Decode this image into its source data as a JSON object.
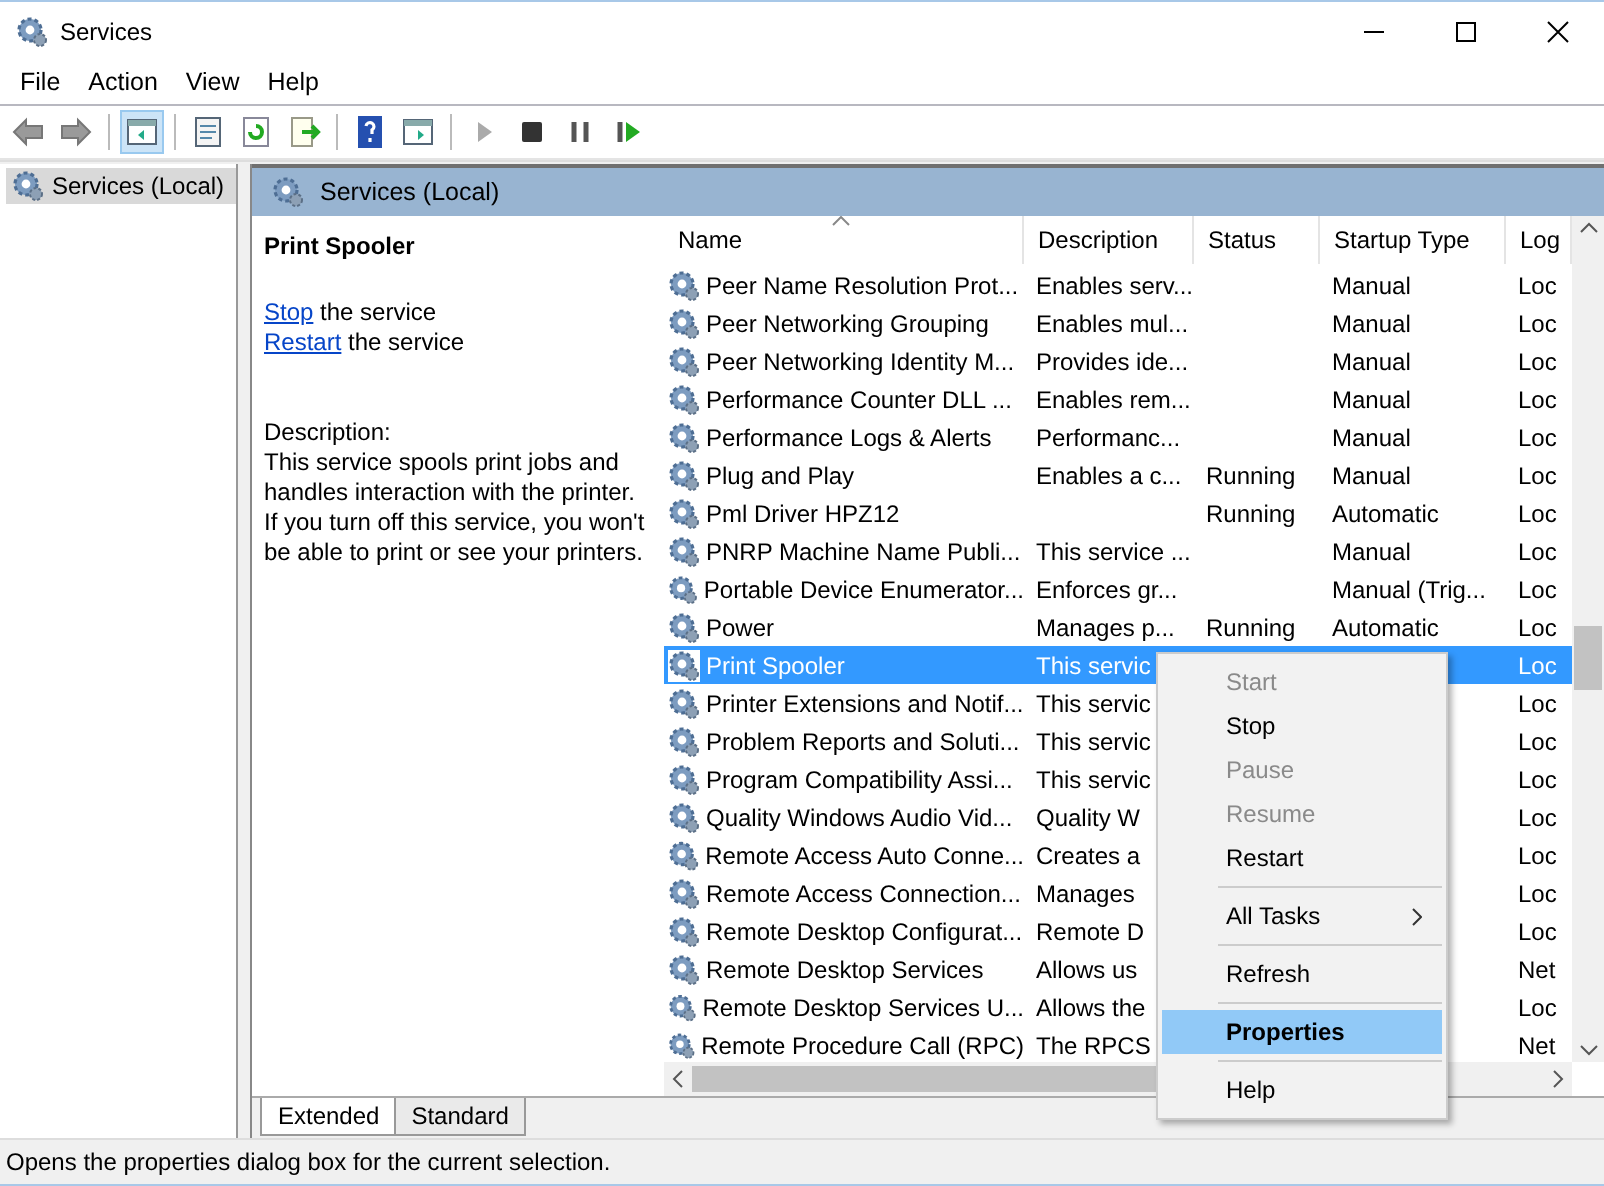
{
  "window": {
    "title": "Services"
  },
  "menu_bar": [
    "File",
    "Action",
    "View",
    "Help"
  ],
  "toolbar": [
    {
      "kind": "back",
      "disabled": true,
      "selected": false
    },
    {
      "kind": "forward",
      "disabled": true,
      "selected": false
    },
    {
      "kind": "sep"
    },
    {
      "kind": "console-tree",
      "disabled": false,
      "selected": true
    },
    {
      "kind": "sep"
    },
    {
      "kind": "properties",
      "selected": false
    },
    {
      "kind": "refresh",
      "selected": false
    },
    {
      "kind": "export",
      "selected": false
    },
    {
      "kind": "sep"
    },
    {
      "kind": "help",
      "selected": false
    },
    {
      "kind": "action-pane",
      "selected": false
    },
    {
      "kind": "sep"
    },
    {
      "kind": "start",
      "disabled": true,
      "selected": false
    },
    {
      "kind": "stop",
      "disabled": false,
      "selected": false
    },
    {
      "kind": "pause",
      "disabled": false,
      "selected": false
    },
    {
      "kind": "resume",
      "disabled": false,
      "selected": false
    }
  ],
  "tree": {
    "items": [
      {
        "label": "Services (Local)",
        "selected": true
      }
    ]
  },
  "pane_header": "Services (Local)",
  "details": {
    "title": "Print Spooler",
    "actions": [
      {
        "link": "Stop",
        "text": "the service"
      },
      {
        "link": "Restart",
        "text": "the service"
      }
    ],
    "description_label": "Description:",
    "description": "This service spools print jobs and handles interaction with the printer. If you turn off this service, you won't be able to print or see your printers."
  },
  "table": {
    "columns": [
      "Name",
      "Description",
      "Status",
      "Startup Type",
      "Log"
    ],
    "rows": [
      {
        "name": "Peer Name Resolution Prot...",
        "description": "Enables serv...",
        "status": "",
        "startup": "Manual",
        "logon": "Loc",
        "selected": false
      },
      {
        "name": "Peer Networking Grouping",
        "description": "Enables mul...",
        "status": "",
        "startup": "Manual",
        "logon": "Loc",
        "selected": false
      },
      {
        "name": "Peer Networking Identity M...",
        "description": "Provides ide...",
        "status": "",
        "startup": "Manual",
        "logon": "Loc",
        "selected": false
      },
      {
        "name": "Performance Counter DLL ...",
        "description": "Enables rem...",
        "status": "",
        "startup": "Manual",
        "logon": "Loc",
        "selected": false
      },
      {
        "name": "Performance Logs & Alerts",
        "description": "Performanc...",
        "status": "",
        "startup": "Manual",
        "logon": "Loc",
        "selected": false
      },
      {
        "name": "Plug and Play",
        "description": "Enables a c...",
        "status": "Running",
        "startup": "Manual",
        "logon": "Loc",
        "selected": false
      },
      {
        "name": "Pml Driver HPZ12",
        "description": "",
        "status": "Running",
        "startup": "Automatic",
        "logon": "Loc",
        "selected": false
      },
      {
        "name": "PNRP Machine Name Publi...",
        "description": "This service ...",
        "status": "",
        "startup": "Manual",
        "logon": "Loc",
        "selected": false
      },
      {
        "name": "Portable Device Enumerator...",
        "description": "Enforces gr...",
        "status": "",
        "startup": "Manual (Trig...",
        "logon": "Loc",
        "selected": false
      },
      {
        "name": "Power",
        "description": "Manages p...",
        "status": "Running",
        "startup": "Automatic",
        "logon": "Loc",
        "selected": false
      },
      {
        "name": "Print Spooler",
        "description": "This servic",
        "status": "",
        "startup": "",
        "logon": "Loc",
        "selected": true
      },
      {
        "name": "Printer Extensions and Notif...",
        "description": "This servic",
        "status": "",
        "startup": "",
        "logon": "Loc",
        "selected": false
      },
      {
        "name": "Problem Reports and Soluti...",
        "description": "This servic",
        "status": "",
        "startup": "",
        "logon": "Loc",
        "selected": false
      },
      {
        "name": "Program Compatibility Assi...",
        "description": "This servic",
        "status": "",
        "startup": "",
        "logon": "Loc",
        "selected": false
      },
      {
        "name": "Quality Windows Audio Vid...",
        "description": "Quality W",
        "status": "",
        "startup": "",
        "logon": "Loc",
        "selected": false
      },
      {
        "name": "Remote Access Auto Conne...",
        "description": "Creates a",
        "status": "",
        "startup": "",
        "logon": "Loc",
        "selected": false
      },
      {
        "name": "Remote Access Connection...",
        "description": "Manages",
        "status": "",
        "startup": "",
        "logon": "Loc",
        "selected": false
      },
      {
        "name": "Remote Desktop Configurat...",
        "description": "Remote D",
        "status": "",
        "startup": "",
        "logon": "Loc",
        "selected": false
      },
      {
        "name": "Remote Desktop Services",
        "description": "Allows us",
        "status": "",
        "startup": "",
        "logon": "Net",
        "selected": false
      },
      {
        "name": "Remote Desktop Services U...",
        "description": "Allows the",
        "status": "",
        "startup": "",
        "logon": "Loc",
        "selected": false
      },
      {
        "name": "Remote Procedure Call (RPC)",
        "description": "The RPCS",
        "status": "",
        "startup": "",
        "logon": "Net",
        "selected": false
      }
    ]
  },
  "view_tabs": [
    {
      "label": "Extended",
      "selected": true
    },
    {
      "label": "Standard",
      "selected": false
    }
  ],
  "context_menu": [
    {
      "kind": "item",
      "label": "Start",
      "disabled": true,
      "selected": false
    },
    {
      "kind": "item",
      "label": "Stop",
      "disabled": false,
      "selected": false
    },
    {
      "kind": "item",
      "label": "Pause",
      "disabled": true,
      "selected": false
    },
    {
      "kind": "item",
      "label": "Resume",
      "disabled": true,
      "selected": false
    },
    {
      "kind": "item",
      "label": "Restart",
      "disabled": false,
      "selected": false
    },
    {
      "kind": "sep"
    },
    {
      "kind": "submenu",
      "label": "All Tasks",
      "disabled": false,
      "selected": false
    },
    {
      "kind": "sep"
    },
    {
      "kind": "item",
      "label": "Refresh",
      "disabled": false,
      "selected": false
    },
    {
      "kind": "sep"
    },
    {
      "kind": "item",
      "label": "Properties",
      "disabled": false,
      "selected": true,
      "bold": true
    },
    {
      "kind": "sep"
    },
    {
      "kind": "item",
      "label": "Help",
      "disabled": false,
      "selected": false
    }
  ],
  "status_bar": "Opens the properties dialog box for the current selection."
}
